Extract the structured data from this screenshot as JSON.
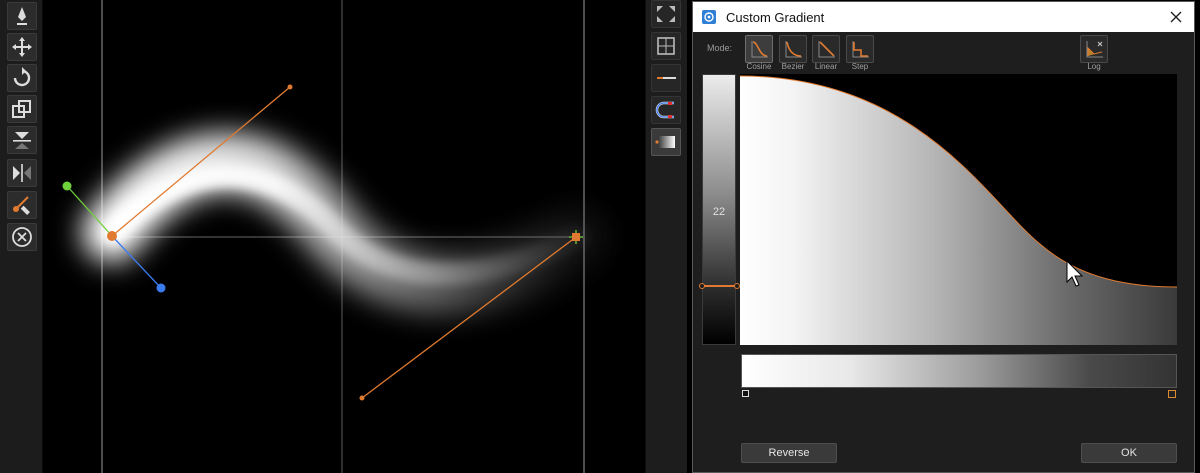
{
  "dialog": {
    "title": "Custom Gradient",
    "mode_label": "Mode:",
    "modes": [
      {
        "label": "Cosine",
        "selected": true
      },
      {
        "label": "Bezier",
        "selected": false
      },
      {
        "label": "Linear",
        "selected": false
      },
      {
        "label": "Step",
        "selected": false
      }
    ],
    "log_label": "Log",
    "opacity_value": "22",
    "reverse_label": "Reverse",
    "ok_label": "OK"
  },
  "colors": {
    "accent_orange": "#e07a30",
    "handle_green": "#6ed23a",
    "handle_blue": "#3a7bef",
    "toolbar_bg": "#1c1c1c",
    "dialog_bg": "#1e1e1e"
  },
  "left_toolbar": [
    "pen-icon",
    "move-icon",
    "rotate-icon",
    "scale-icon",
    "align-icon",
    "mirror-icon",
    "node-edit-icon",
    "cancel-icon"
  ],
  "right_toolbar": [
    "expand-icon",
    "grid-icon",
    "line-style-icon",
    "magnet-icon",
    "gradient-icon"
  ]
}
